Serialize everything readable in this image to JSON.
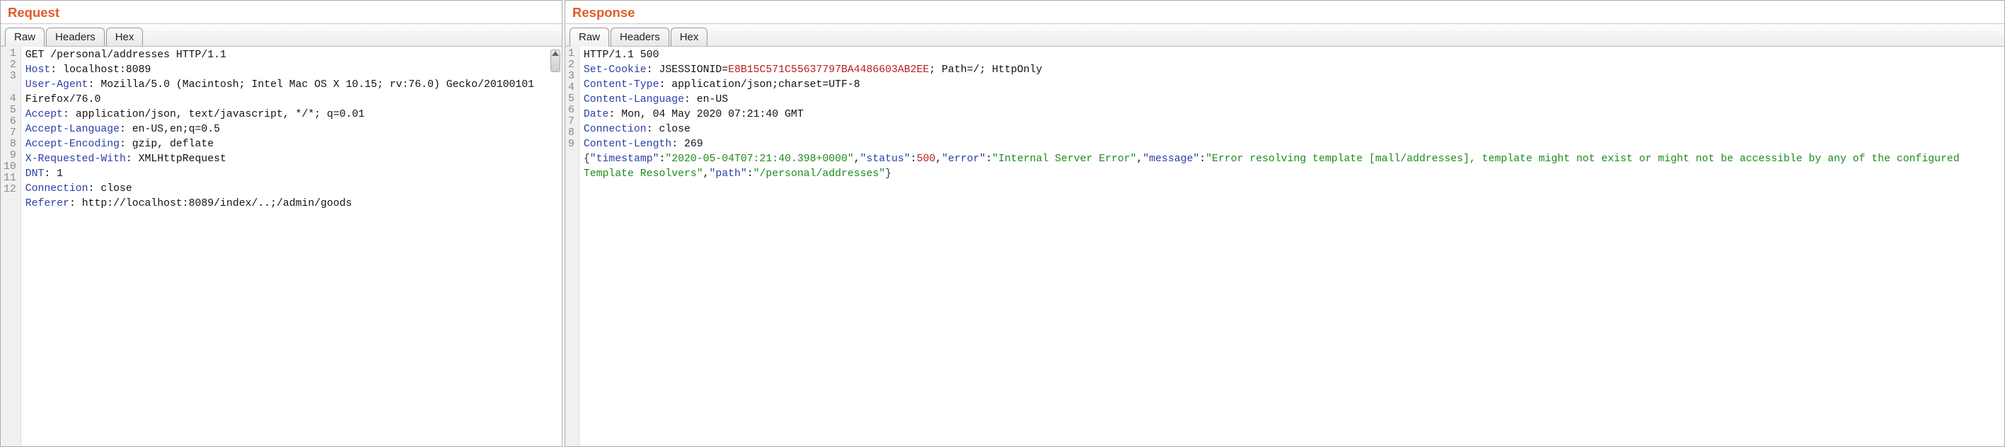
{
  "request": {
    "title": "Request",
    "tabs": {
      "raw": "Raw",
      "headers": "Headers",
      "hex": "Hex",
      "active": "raw"
    },
    "lines": [
      {
        "n": "1",
        "plain": "GET /personal/addresses HTTP/1.1"
      },
      {
        "n": "2",
        "header": "Host",
        "value": "localhost:8089"
      },
      {
        "n": "3",
        "header": "User-Agent",
        "value": "Mozilla/5.0 (Macintosh; Intel Mac OS X 10.15; rv:76.0) Gecko/20100101 Firefox/76.0",
        "wrap": true
      },
      {
        "n": "4",
        "header": "Accept",
        "value": "application/json, text/javascript, */*; q=0.01"
      },
      {
        "n": "5",
        "header": "Accept-Language",
        "value": "en-US,en;q=0.5"
      },
      {
        "n": "6",
        "header": "Accept-Encoding",
        "value": "gzip, deflate"
      },
      {
        "n": "7",
        "header": "X-Requested-With",
        "value": "XMLHttpRequest"
      },
      {
        "n": "8",
        "header": "DNT",
        "value": "1"
      },
      {
        "n": "9",
        "header": "Connection",
        "value": "close"
      },
      {
        "n": "10",
        "header": "Referer",
        "value": "http://localhost:8089/index/..;/admin/goods"
      },
      {
        "n": "11",
        "plain": ""
      },
      {
        "n": "12",
        "plain": ""
      }
    ]
  },
  "response": {
    "title": "Response",
    "tabs": {
      "raw": "Raw",
      "headers": "Headers",
      "hex": "Hex",
      "active": "raw"
    },
    "lines": [
      {
        "n": "1",
        "plain": "HTTP/1.1 500"
      },
      {
        "n": "2",
        "header": "Set-Cookie",
        "value_parts": {
          "pre": "JSESSIONID=",
          "sessid": "E8B15C571C55637797BA4486603AB2EE",
          "post": "; Path=/; HttpOnly"
        }
      },
      {
        "n": "3",
        "header": "Content-Type",
        "value": "application/json;charset=UTF-8"
      },
      {
        "n": "4",
        "header": "Content-Language",
        "value": "en-US"
      },
      {
        "n": "5",
        "header": "Date",
        "value": "Mon, 04 May 2020 07:21:40 GMT"
      },
      {
        "n": "6",
        "header": "Connection",
        "value": "close"
      },
      {
        "n": "7",
        "header": "Content-Length",
        "value": "269"
      },
      {
        "n": "8",
        "plain": ""
      },
      {
        "n": "9",
        "json": {
          "timestamp_k": "\"timestamp\"",
          "timestamp_v": "\"2020-05-04T07:21:40.398+0000\"",
          "status_k": "\"status\"",
          "status_v": "500",
          "error_k": "\"error\"",
          "error_v": "\"Internal Server Error\"",
          "message_k": "\"message\"",
          "message_v": "\"Error resolving template [mall/addresses], template might not exist or might not be accessible by any of the configured Template Resolvers\"",
          "path_k": "\"path\"",
          "path_v": "\"/personal/addresses\""
        }
      }
    ]
  }
}
